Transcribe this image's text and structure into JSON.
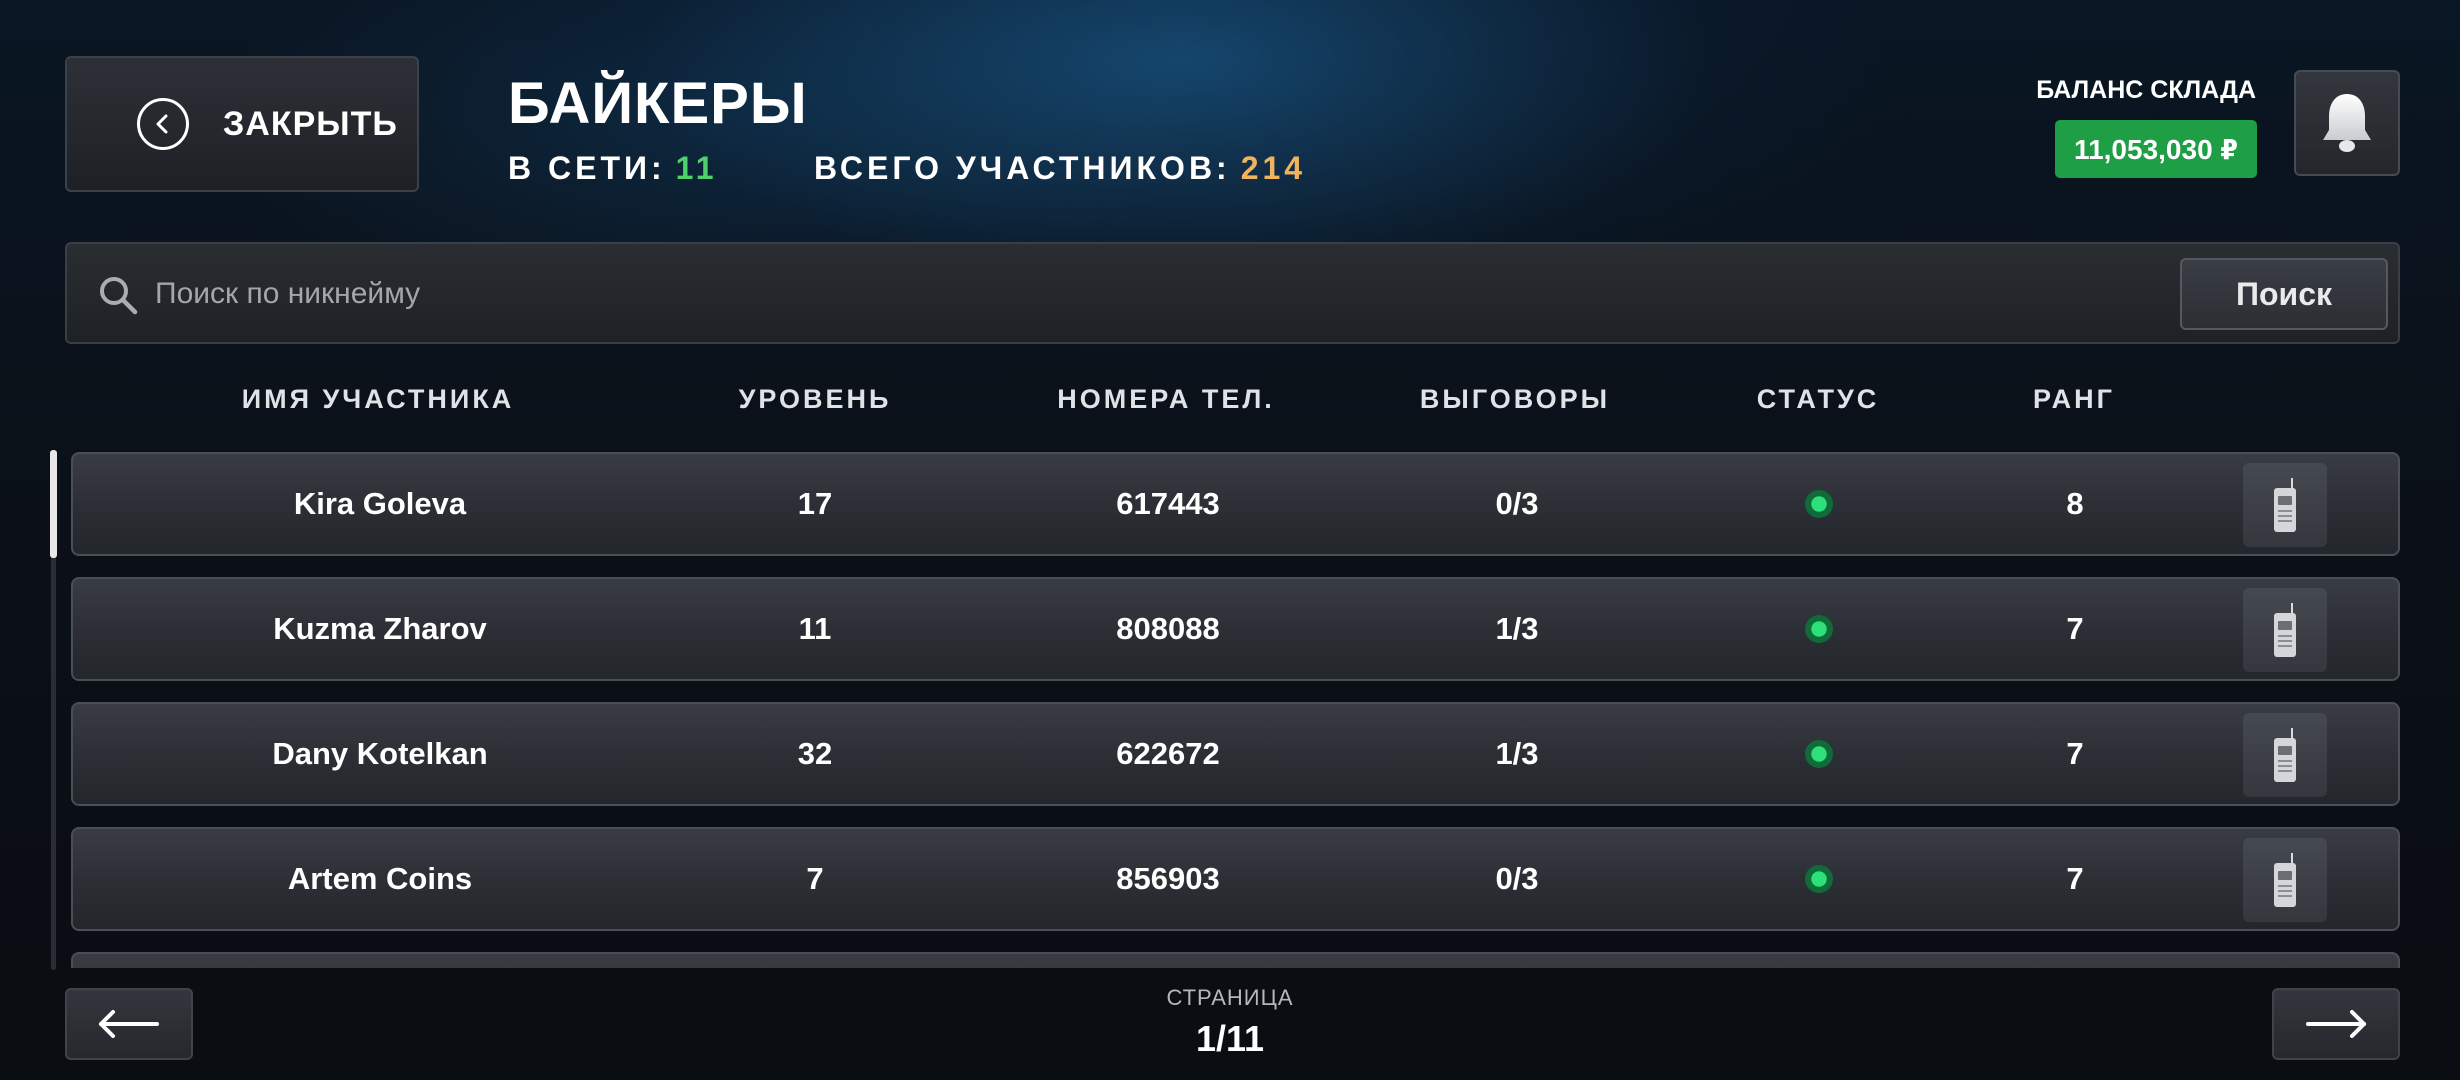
{
  "header": {
    "close_label": "ЗАКРЫТЬ",
    "title": "БАЙКЕРЫ",
    "online_label": "В СЕТИ:",
    "online_count": "11",
    "total_label": "ВСЕГО УЧАСТНИКОВ:",
    "total_count": "214",
    "balance_label": "БАЛАНС СКЛАДА",
    "balance_value": "11,053,030 ₽"
  },
  "search": {
    "placeholder": "Поиск по никнейму",
    "value": "",
    "button_label": "Поиск"
  },
  "columns": [
    "ИМЯ УЧАСТНИКА",
    "УРОВЕНЬ",
    "НОМЕРА ТЕЛ.",
    "ВЫГОВОРЫ",
    "СТАТУС",
    "РАНГ"
  ],
  "members": [
    {
      "name": "Kira Goleva",
      "level": "17",
      "phone": "617443",
      "warnings": "0/3",
      "status": "online",
      "rank": "8"
    },
    {
      "name": "Kuzma Zharov",
      "level": "11",
      "phone": "808088",
      "warnings": "1/3",
      "status": "online",
      "rank": "7"
    },
    {
      "name": "Dany Kotelkan",
      "level": "32",
      "phone": "622672",
      "warnings": "1/3",
      "status": "online",
      "rank": "7"
    },
    {
      "name": "Artem Coins",
      "level": "7",
      "phone": "856903",
      "warnings": "0/3",
      "status": "online",
      "rank": "7"
    }
  ],
  "pagination": {
    "label": "СТРАНИЦА",
    "current": "1/11"
  },
  "colors": {
    "online_green": "#4ed06b",
    "total_orange": "#f1b45e",
    "balance_bg": "#1f9f45",
    "status_dot": "#2de07a"
  },
  "icons": {
    "close": "chevron-left-circle-icon",
    "bell": "bell-icon",
    "search": "search-icon",
    "row_action": "walkie-talkie-icon",
    "prev": "arrow-left-icon",
    "next": "arrow-right-icon"
  }
}
